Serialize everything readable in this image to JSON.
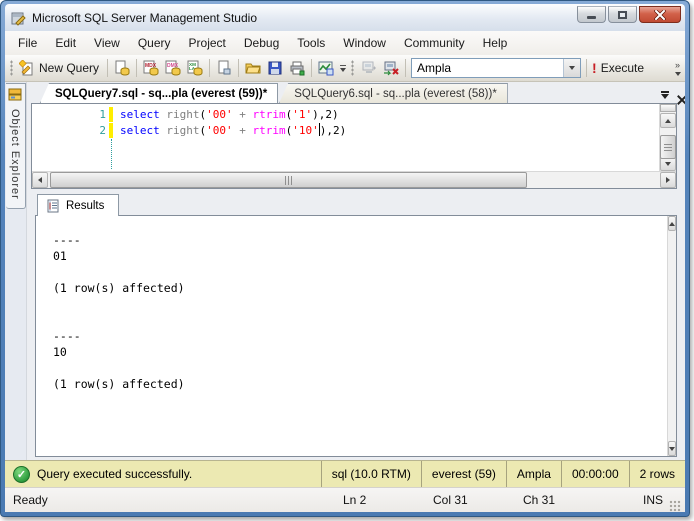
{
  "window": {
    "title": "Microsoft SQL Server Management Studio"
  },
  "menu": {
    "items": [
      "File",
      "Edit",
      "View",
      "Query",
      "Project",
      "Debug",
      "Tools",
      "Window",
      "Community",
      "Help"
    ]
  },
  "toolbar": {
    "new_query": "New Query",
    "mdx": "MDX",
    "dmx": "DMX",
    "xmla_top": "XM",
    "xmla_bottom": "LA",
    "database": "Ampla",
    "execute_bang": "!",
    "execute": "Execute"
  },
  "object_explorer": {
    "label": "Object Explorer"
  },
  "tabs": [
    {
      "id": "sqlquery7",
      "label": "SQLQuery7.sql - sq...pla (everest (59))*",
      "active": true
    },
    {
      "id": "sqlquery6",
      "label": "SQLQuery6.sql - sq...pla (everest (58))*",
      "active": false
    }
  ],
  "editor": {
    "colors": {
      "keyword": "#0000ff",
      "string": "#ff0000",
      "function": "#ff00ff",
      "gray": "#808080",
      "plain": "#000000"
    },
    "lines": [
      {
        "number": "1",
        "tokens": [
          [
            "select",
            "keyword"
          ],
          [
            " ",
            "plain"
          ],
          [
            "right",
            "gray"
          ],
          [
            "(",
            "plain"
          ],
          [
            "'00'",
            "string"
          ],
          [
            " ",
            "plain"
          ],
          [
            "+",
            "gray"
          ],
          [
            " ",
            "plain"
          ],
          [
            "rtrim",
            "function"
          ],
          [
            "(",
            "plain"
          ],
          [
            "'1'",
            "string"
          ],
          [
            "),2)",
            "plain"
          ]
        ]
      },
      {
        "number": "2",
        "tokens": [
          [
            "select",
            "keyword"
          ],
          [
            " ",
            "plain"
          ],
          [
            "right",
            "gray"
          ],
          [
            "(",
            "plain"
          ],
          [
            "'00'",
            "string"
          ],
          [
            " ",
            "plain"
          ],
          [
            "+",
            "gray"
          ],
          [
            " ",
            "plain"
          ],
          [
            "rtrim",
            "function"
          ],
          [
            "(",
            "plain"
          ],
          [
            "'10'",
            "string"
          ],
          [
            "",
            "caret"
          ],
          [
            "),2)",
            "plain"
          ]
        ]
      }
    ]
  },
  "results": {
    "tab_label": "Results",
    "lines": [
      "----",
      "01",
      "",
      "(1 row(s) affected)",
      "",
      "",
      "----",
      "10",
      "",
      "(1 row(s) affected)"
    ]
  },
  "status": {
    "message": "Query executed successfully.",
    "check_glyph": "✓",
    "cells": [
      "sql (10.0 RTM)",
      "everest (59)",
      "Ampla",
      "00:00:00",
      "2 rows"
    ]
  },
  "statusbar": {
    "ready": "Ready",
    "line": "Ln 2",
    "column": "Col 31",
    "char": "Ch 31",
    "mode": "INS"
  },
  "colors": {
    "frame_blue": "#5584bb",
    "status_yellow": "#ece9b2",
    "execute_red": "#c71f25",
    "check_green": "#2f9e3f",
    "line_number_teal": "#2f9e9e",
    "change_bar_yellow": "#ffee00"
  }
}
